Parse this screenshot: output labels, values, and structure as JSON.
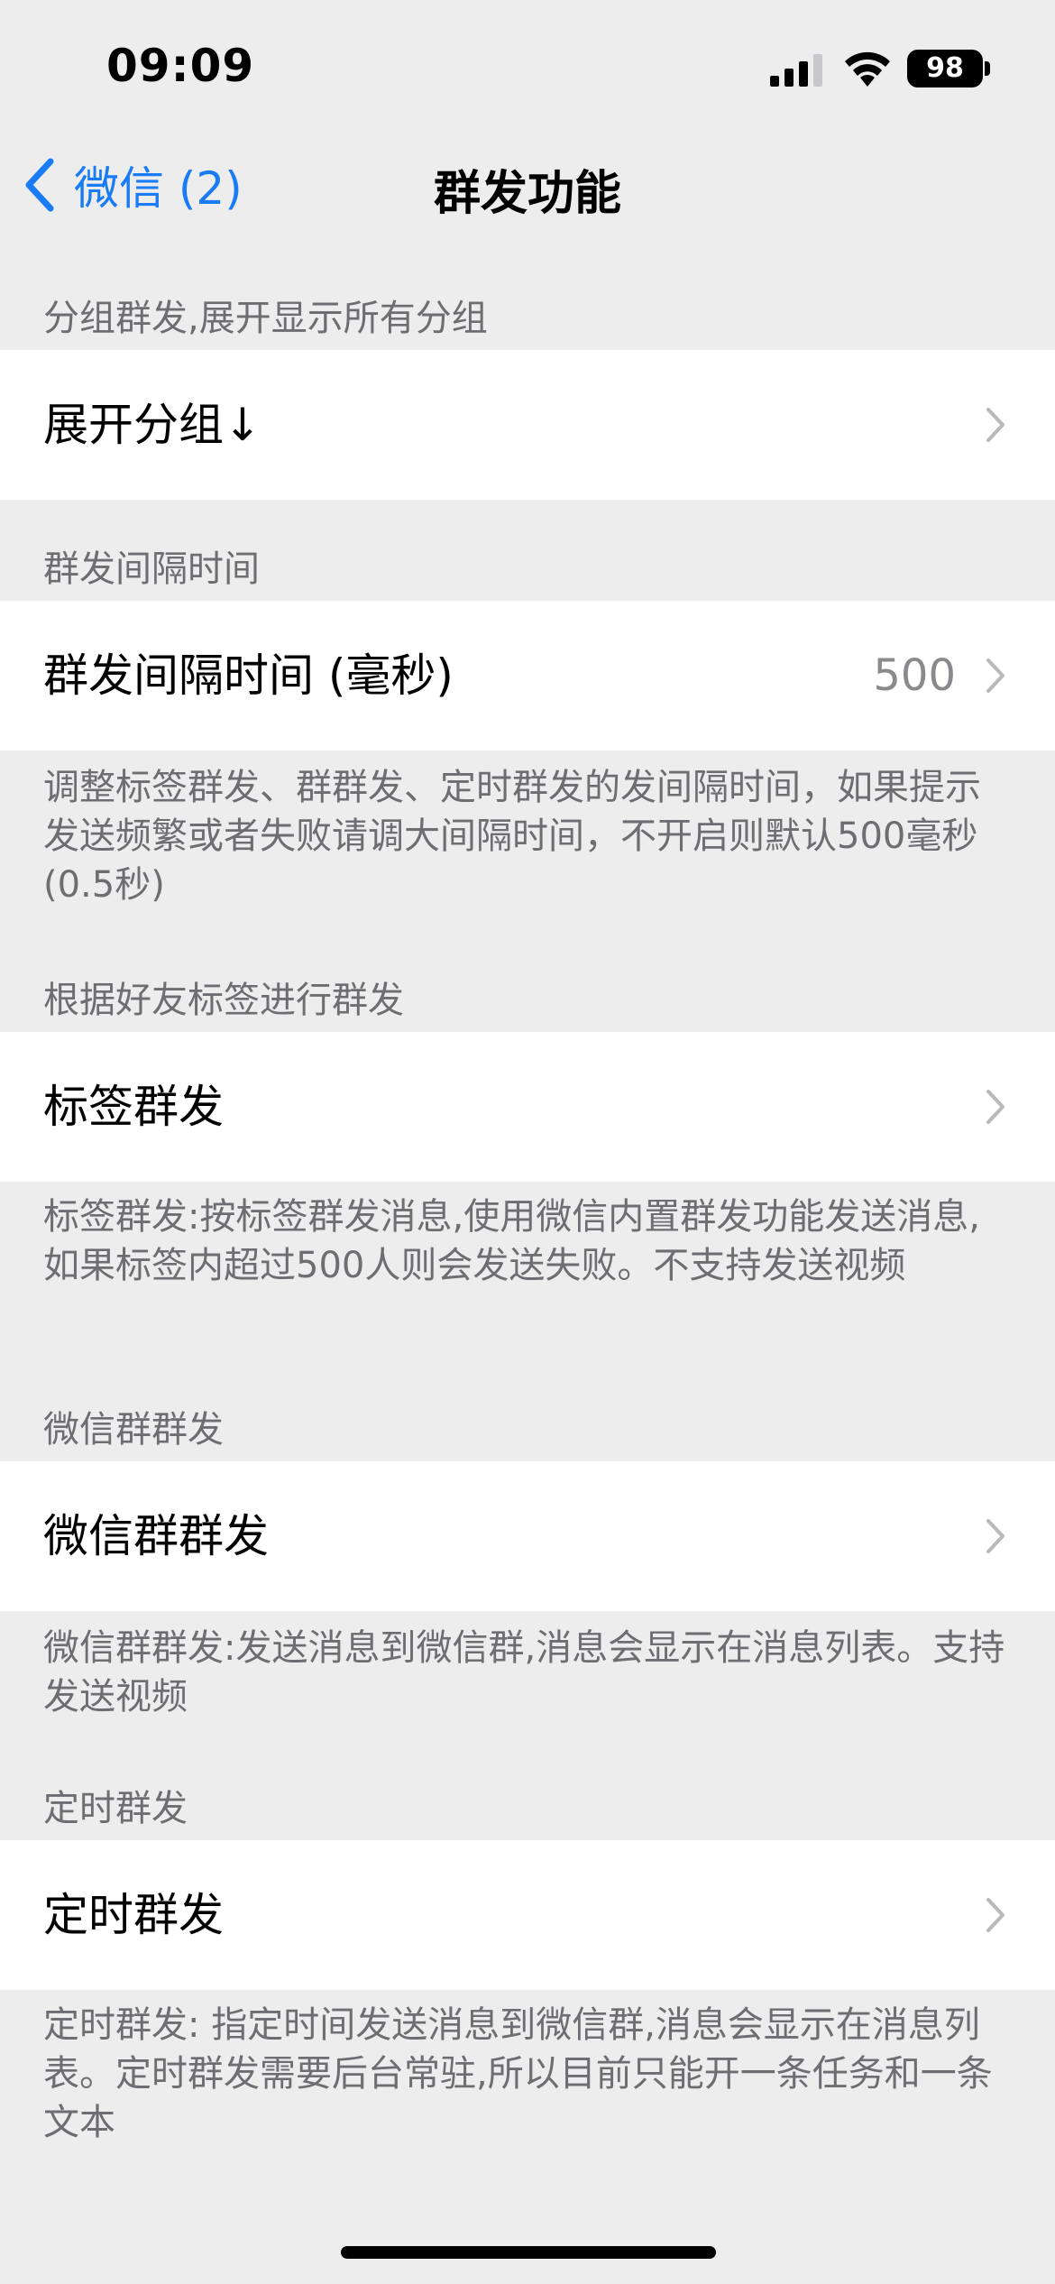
{
  "status_bar": {
    "time": "09:09",
    "battery": "98",
    "signal_icon": "cellular-signal-icon",
    "wifi_icon": "wifi-icon"
  },
  "nav": {
    "back_label": "微信 (2)",
    "title": "群发功能",
    "accent_color": "#1a7cf5"
  },
  "sections": [
    {
      "header": "分组群发,展开显示所有分组",
      "row_label": "展开分组↓",
      "row_value": "",
      "footer": ""
    },
    {
      "header": "群发间隔时间",
      "row_label": "群发间隔时间 (毫秒)",
      "row_value": "500",
      "footer": "调整标签群发、群群发、定时群发的发间隔时间，如果提示发送频繁或者失败请调大间隔时间，不开启则默认500毫秒(0.5秒)"
    },
    {
      "header": "根据好友标签进行群发",
      "row_label": "标签群发",
      "row_value": "",
      "footer": "标签群发:按标签群发消息,使用微信内置群发功能发送消息,如果标签内超过500人则会发送失败。不支持发送视频"
    },
    {
      "header": "微信群群发",
      "row_label": "微信群群发",
      "row_value": "",
      "footer": "微信群群发:发送消息到微信群,消息会显示在消息列表。支持发送视频"
    },
    {
      "header": "定时群发",
      "row_label": "定时群发",
      "row_value": "",
      "footer": "定时群发: 指定时间发送消息到微信群,消息会显示在消息列表。定时群发需要后台常驻,所以目前只能开一条任务和一条文本"
    }
  ]
}
